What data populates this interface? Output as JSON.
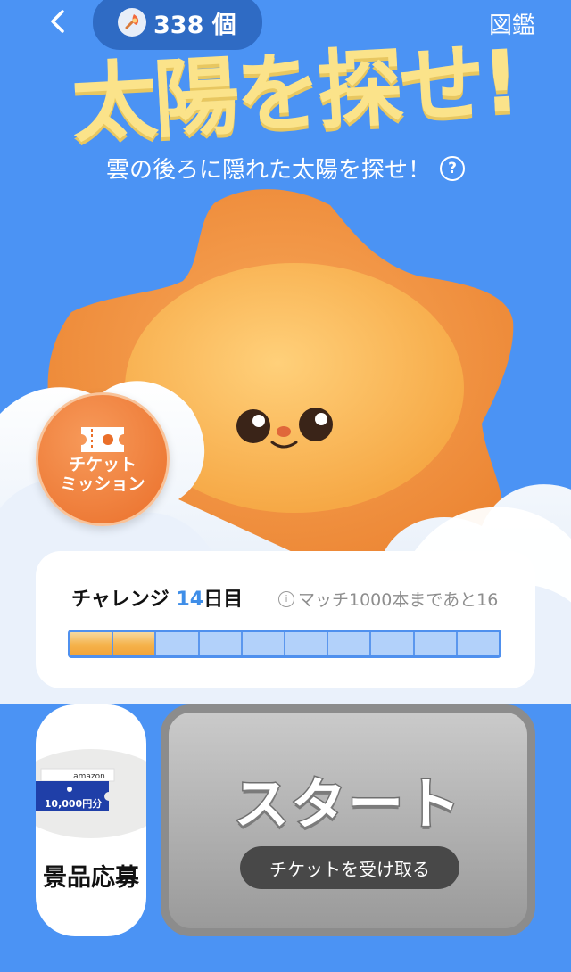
{
  "header": {
    "match_count": "338 個",
    "zukan_label": "図鑑"
  },
  "hero": {
    "title": "太陽を探せ!",
    "subtitle": "雲の後ろに隠れた太陽を探せ！",
    "help_symbol": "?"
  },
  "mission": {
    "label_line1": "チケット",
    "label_line2": "ミッション"
  },
  "challenge": {
    "label": "チャレンジ",
    "day_number": "14",
    "day_suffix": "日目",
    "note": "マッチ1000本まであと16",
    "segments_total": 10,
    "segments_done": 2
  },
  "prize": {
    "amazon_text": "amazon",
    "gift_amount": "10,000円分",
    "label": "景品応募"
  },
  "start": {
    "label": "スタート",
    "ticket_button": "チケットを受け取る"
  },
  "colors": {
    "background": "#4b93f4",
    "title": "#fbe38a",
    "mission": "#ea6f2a",
    "progress_done": "#f5b24a",
    "progress_empty": "#b2d1fa",
    "start_button": "#9a9a9a"
  },
  "icons": {
    "back": "chevron-left-icon",
    "match": "match-icon",
    "ticket": "ticket-icon",
    "info": "info-icon",
    "help": "question-icon"
  }
}
